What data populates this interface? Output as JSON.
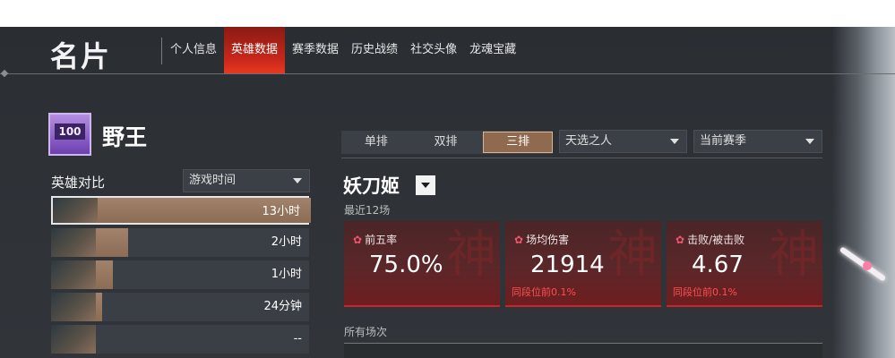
{
  "header": {
    "title": "名片",
    "tabs": [
      {
        "label": "个人信息",
        "active": false
      },
      {
        "label": "英雄数据",
        "active": true
      },
      {
        "label": "赛季数据",
        "active": false
      },
      {
        "label": "历史战绩",
        "active": false
      },
      {
        "label": "社交头像",
        "active": false
      },
      {
        "label": "龙魂宝藏",
        "active": false
      }
    ]
  },
  "player": {
    "rank_badge": "100",
    "name": "野王"
  },
  "modes": {
    "buttons": [
      {
        "label": "单排",
        "active": false
      },
      {
        "label": "双排",
        "active": false
      },
      {
        "label": "三排",
        "active": true
      }
    ],
    "mode_select": "天选之人",
    "season_select": "当前赛季"
  },
  "compare": {
    "title": "英雄对比",
    "sort_select": "游戏时间",
    "heroes": [
      {
        "time": "13小时",
        "fill": 1.0,
        "selected": true
      },
      {
        "time": "2小时",
        "fill": 0.15,
        "selected": false
      },
      {
        "time": "1小时",
        "fill": 0.08,
        "selected": false
      },
      {
        "time": "24分钟",
        "fill": 0.03,
        "selected": false
      },
      {
        "time": "--",
        "fill": 0.0,
        "selected": false
      }
    ]
  },
  "hero_detail": {
    "name": "妖刀姬",
    "recent_label": "最近12场",
    "cards": [
      {
        "label": "前五率",
        "value": "75.0%",
        "sub": ""
      },
      {
        "label": "场均伤害",
        "value": "21914",
        "sub": "同段位前0.1%"
      },
      {
        "label": "击败/被击败",
        "value": "4.67",
        "sub": "同段位前0.1%"
      }
    ],
    "watermark": "神",
    "all_label": "所有场次"
  },
  "colors": {
    "active_tab": "#c8281b",
    "accent_gold": "#8f6a4e",
    "card_red": "#5b2729",
    "sub_red": "#ff4f4f"
  }
}
